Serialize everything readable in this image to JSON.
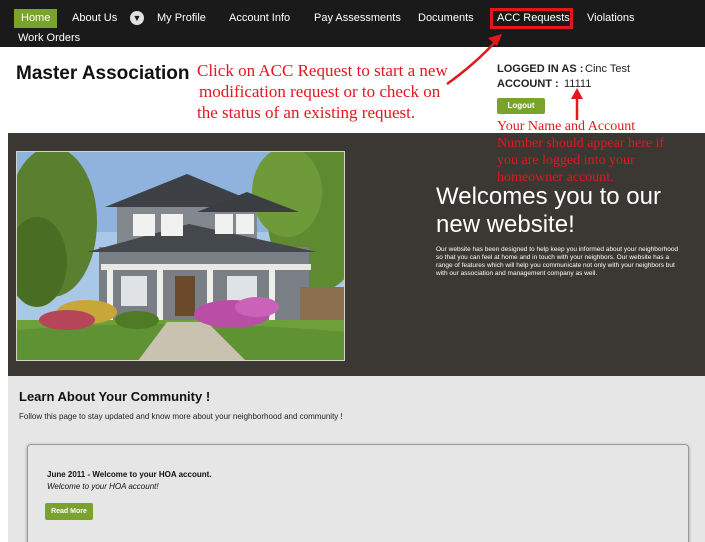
{
  "nav": {
    "items": [
      "Home",
      "About Us",
      "My Profile",
      "Account Info",
      "Pay Assessments",
      "Documents",
      "ACC Requests",
      "Violations",
      "Work Orders"
    ],
    "dropdown_icon": "chevron-down-icon",
    "active_color": "#7aa32d",
    "highlight_color": "#e8141c"
  },
  "header": {
    "title": "Master Association",
    "annotation_lines": [
      "Click on ACC Request to start a new",
      "modification request or to check on",
      "the status of an existing request."
    ]
  },
  "login": {
    "logged_in_label": "LOGGED IN AS :",
    "logged_in_value": "Cinc Test",
    "account_label": "ACCOUNT :",
    "account_value": "11111",
    "logout_label": "Logout",
    "annotation_lines": [
      "Your Name and Account",
      "Number should appear here if",
      "you are logged into your",
      "homeowner account."
    ]
  },
  "hero": {
    "welcome_title": "Welcomes you to our new website!",
    "welcome_body": "Our website has been designed to help keep you informed about your neighborhood so that you can feel at home and in touch with your neighbors. Our website has a range of features which will help you communicate not only with your neighbors but with our association and management company as well."
  },
  "community": {
    "title": "Learn About Your Community !",
    "description": "Follow this page to stay updated and know more about your neighborhood and community !",
    "post": {
      "title": "June 2011 - Welcome to your HOA account.",
      "subtitle": "Welcome to your HOA account!",
      "read_more_label": "Read More"
    }
  },
  "colors": {
    "nav_bg": "#1a1a1a",
    "accent_green": "#7aa32d",
    "hero_bg": "#3b3733",
    "annotation_red": "#e3171d",
    "section_bg": "#e6e6e6"
  }
}
